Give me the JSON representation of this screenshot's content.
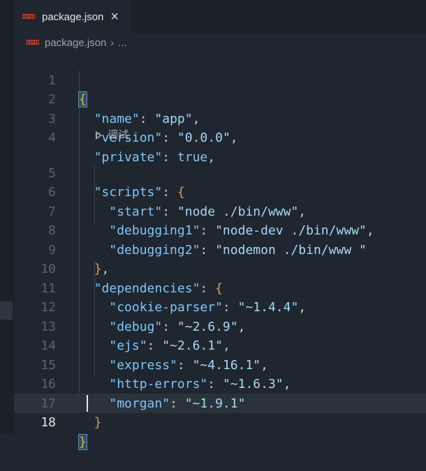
{
  "tab": {
    "label": "package.json",
    "close_symbol": "×",
    "icon": "npm-icon"
  },
  "breadcrumb": {
    "file": "package.json",
    "separator": "›",
    "more": "..."
  },
  "codelens": {
    "label": "调试",
    "icon": "play-icon"
  },
  "editor": {
    "active_line": 18
  },
  "lines": [
    {
      "n": "1"
    },
    {
      "n": "2",
      "key": "\"name\"",
      "value": "\"app\""
    },
    {
      "n": "3",
      "key": "\"version\"",
      "value": "\"0.0.0\""
    },
    {
      "n": "4",
      "key": "\"private\"",
      "value": "true"
    },
    {
      "n": "5",
      "key": "\"scripts\""
    },
    {
      "n": "6",
      "key": "\"start\"",
      "value": "\"node ./bin/www\""
    },
    {
      "n": "7",
      "key": "\"debugging1\"",
      "value": "\"node-dev ./bin/www\""
    },
    {
      "n": "8",
      "key": "\"debugging2\"",
      "value": "\"nodemon ./bin/www \""
    },
    {
      "n": "9"
    },
    {
      "n": "10",
      "key": "\"dependencies\""
    },
    {
      "n": "11",
      "key": "\"cookie-parser\"",
      "value": "\"~1.4.4\""
    },
    {
      "n": "12",
      "key": "\"debug\"",
      "value": "\"~2.6.9\""
    },
    {
      "n": "13",
      "key": "\"ejs\"",
      "value": "\"~2.6.1\""
    },
    {
      "n": "14",
      "key": "\"express\"",
      "value": "\"~4.16.1\""
    },
    {
      "n": "15",
      "key": "\"http-errors\"",
      "value": "\"~1.6.3\""
    },
    {
      "n": "16",
      "key": "\"morgan\"",
      "value": "\"~1.9.1\""
    },
    {
      "n": "17"
    },
    {
      "n": "18"
    }
  ],
  "colors": {
    "background": "#1f2630",
    "key": "#7fc7f7",
    "string": "#a8d9f4",
    "brace": "#e59a55"
  }
}
